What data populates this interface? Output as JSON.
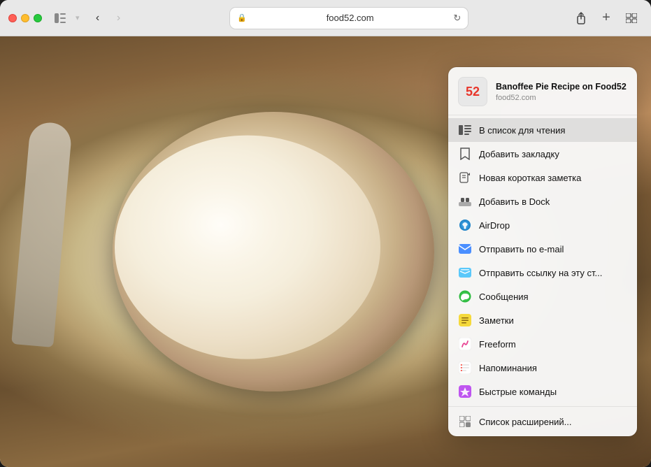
{
  "browser": {
    "url": "food52.com",
    "title": "Banoffee Pie Recipe on Food52",
    "back_enabled": true,
    "forward_enabled": false
  },
  "traffic_lights": {
    "close": "close",
    "minimize": "minimize",
    "maximize": "maximize"
  },
  "share_menu": {
    "site_icon_text": "52",
    "site_title": "Banoffee Pie Recipe on\nFood52",
    "site_url": "food52.com",
    "items": [
      {
        "id": "reading-list",
        "label": "В список для чтения",
        "icon_type": "glasses",
        "highlighted": true
      },
      {
        "id": "bookmark",
        "label": "Добавить закладку",
        "icon_type": "bookmark"
      },
      {
        "id": "new-note",
        "label": "Новая короткая заметка",
        "icon_type": "note"
      },
      {
        "id": "add-dock",
        "label": "Добавить в Dock",
        "icon_type": "dock"
      },
      {
        "id": "airdrop",
        "label": "AirDrop",
        "icon_type": "airdrop"
      },
      {
        "id": "send-mail",
        "label": "Отправить по e-mail",
        "icon_type": "mail"
      },
      {
        "id": "send-link",
        "label": "Отправить ссылку на эту ст...",
        "icon_type": "mail-blue"
      },
      {
        "id": "messages",
        "label": "Сообщения",
        "icon_type": "messages"
      },
      {
        "id": "notes",
        "label": "Заметки",
        "icon_type": "notes"
      },
      {
        "id": "freeform",
        "label": "Freeform",
        "icon_type": "freeform"
      },
      {
        "id": "reminders",
        "label": "Напоминания",
        "icon_type": "reminders"
      },
      {
        "id": "shortcuts",
        "label": "Быстрые команды",
        "icon_type": "shortcuts"
      },
      {
        "id": "extensions",
        "label": "Список расширений...",
        "icon_type": "extensions",
        "divider_before": true
      }
    ]
  }
}
